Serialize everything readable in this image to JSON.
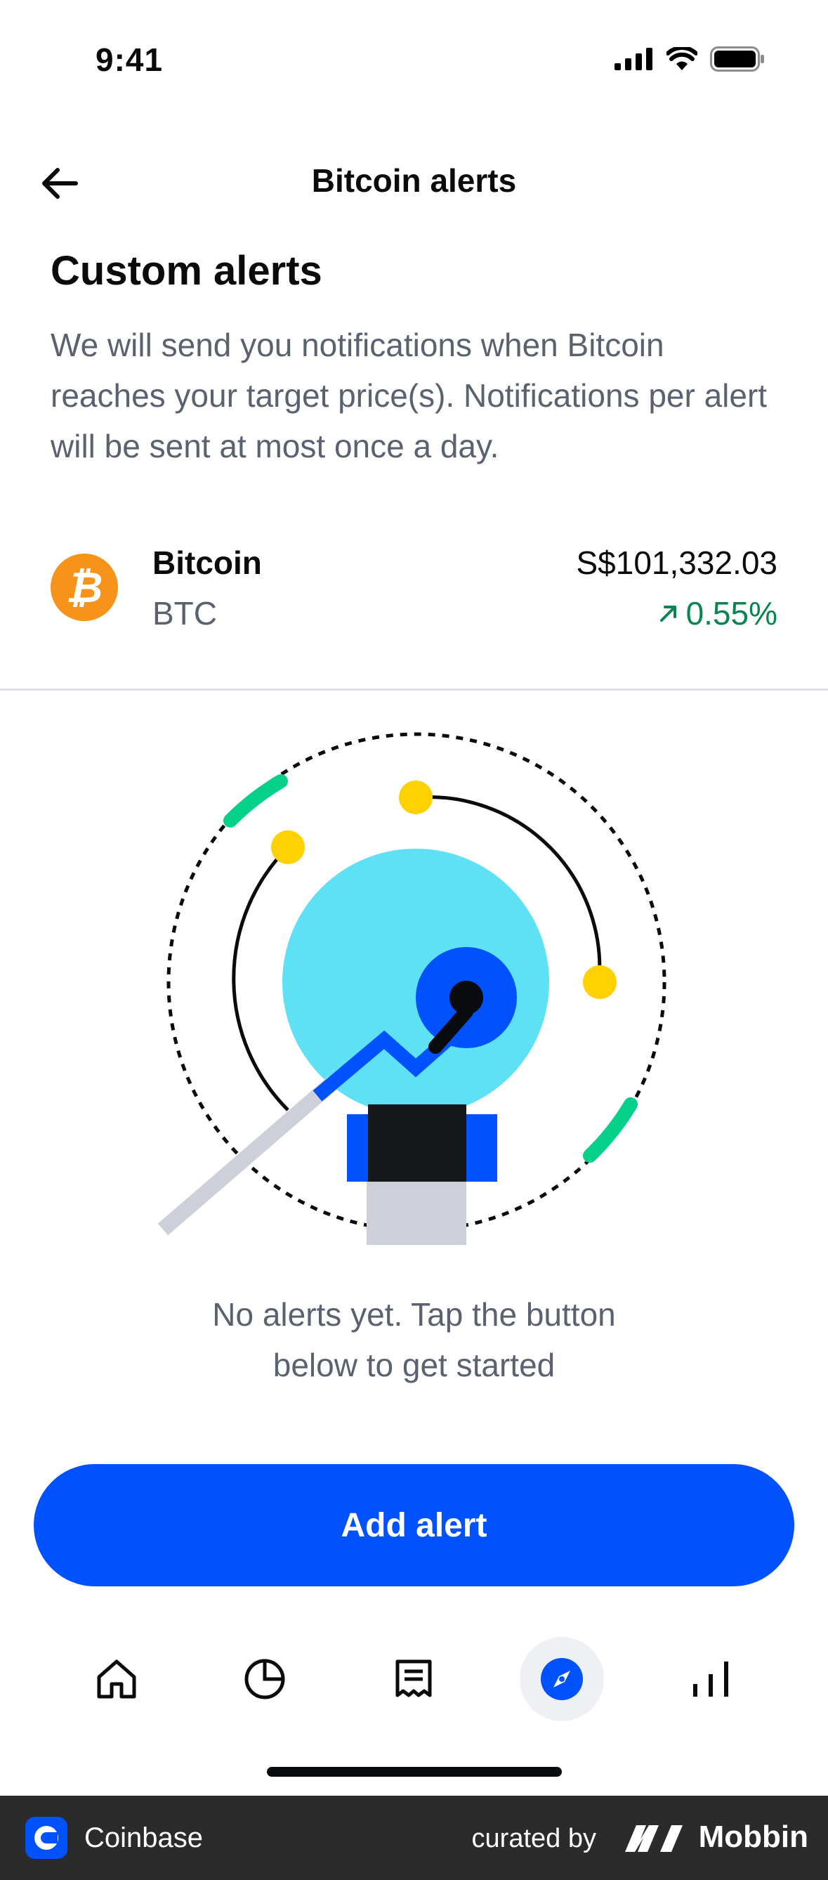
{
  "status_bar": {
    "time": "9:41"
  },
  "header": {
    "title": "Bitcoin alerts"
  },
  "intro": {
    "title": "Custom alerts",
    "description": "We will send you notifications when Bitcoin reaches your target price(s). Notifications per alert will be sent at most once a day."
  },
  "asset": {
    "logo_glyph": "₿",
    "name": "Bitcoin",
    "ticker": "BTC",
    "price": "S$101,332.03",
    "change": "0.55%",
    "change_direction": "up",
    "change_color": "#098551",
    "logo_color": "#f7931a"
  },
  "empty_state": {
    "line1": "No alerts yet. Tap the button",
    "line2": "below to get started"
  },
  "primary_action": {
    "label": "Add alert",
    "color": "#0052ff"
  },
  "tab_bar": {
    "items": [
      {
        "icon": "home-icon",
        "active": false
      },
      {
        "icon": "portfolio-pie-icon",
        "active": false
      },
      {
        "icon": "transactions-receipt-icon",
        "active": false
      },
      {
        "icon": "explore-compass-icon",
        "active": true
      },
      {
        "icon": "stats-bar-icon",
        "active": false
      }
    ]
  },
  "footer": {
    "app_name": "Coinbase",
    "curated_by": "curated by",
    "brand": "Mobbin"
  }
}
